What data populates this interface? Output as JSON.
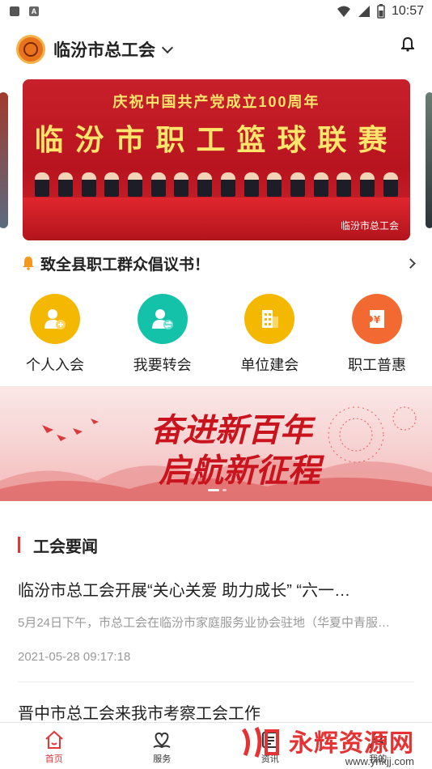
{
  "status_bar": {
    "time": "10:57"
  },
  "header": {
    "title": "临汾市总工会"
  },
  "banner": {
    "top_text": "庆祝中国共产党成立100周年",
    "main_text": "临汾市职工篮球联赛",
    "mark": "临汾市总工会"
  },
  "notice": {
    "text": "致全县职工群众倡议书！"
  },
  "quick_entries": [
    {
      "label": "个人入会",
      "color": "#f5b800",
      "icon": "person-add-icon"
    },
    {
      "label": "我要转会",
      "color": "#13c2a9",
      "icon": "person-transfer-icon"
    },
    {
      "label": "单位建会",
      "color": "#f5b800",
      "icon": "building-icon"
    },
    {
      "label": "职工普惠",
      "color": "#f26a32",
      "icon": "coupon-icon"
    }
  ],
  "promo": {
    "line1": "奋进新百年",
    "line2": "启航新征程"
  },
  "news_section": {
    "title": "工会要闻"
  },
  "news": [
    {
      "title": "临汾市总工会开展“关心关爱 助力成长” “六一…",
      "summary": "5月24日下午，市总工会在临汾市家庭服务业协会驻地（华夏中青服…",
      "date": "2021-05-28 09:17:18"
    },
    {
      "title": "晋中市总工会来我市考察工会工作"
    }
  ],
  "tabbar": [
    {
      "label": "首页",
      "active": true
    },
    {
      "label": "服务",
      "active": false
    },
    {
      "label": "资讯",
      "active": false
    },
    {
      "label": "我的",
      "active": false
    }
  ],
  "watermark": {
    "top": "永辉资源网",
    "bottom": "www.yhkjj.com"
  },
  "colors": {
    "accent": "#e4353b",
    "banner_red": "#c8202a"
  }
}
